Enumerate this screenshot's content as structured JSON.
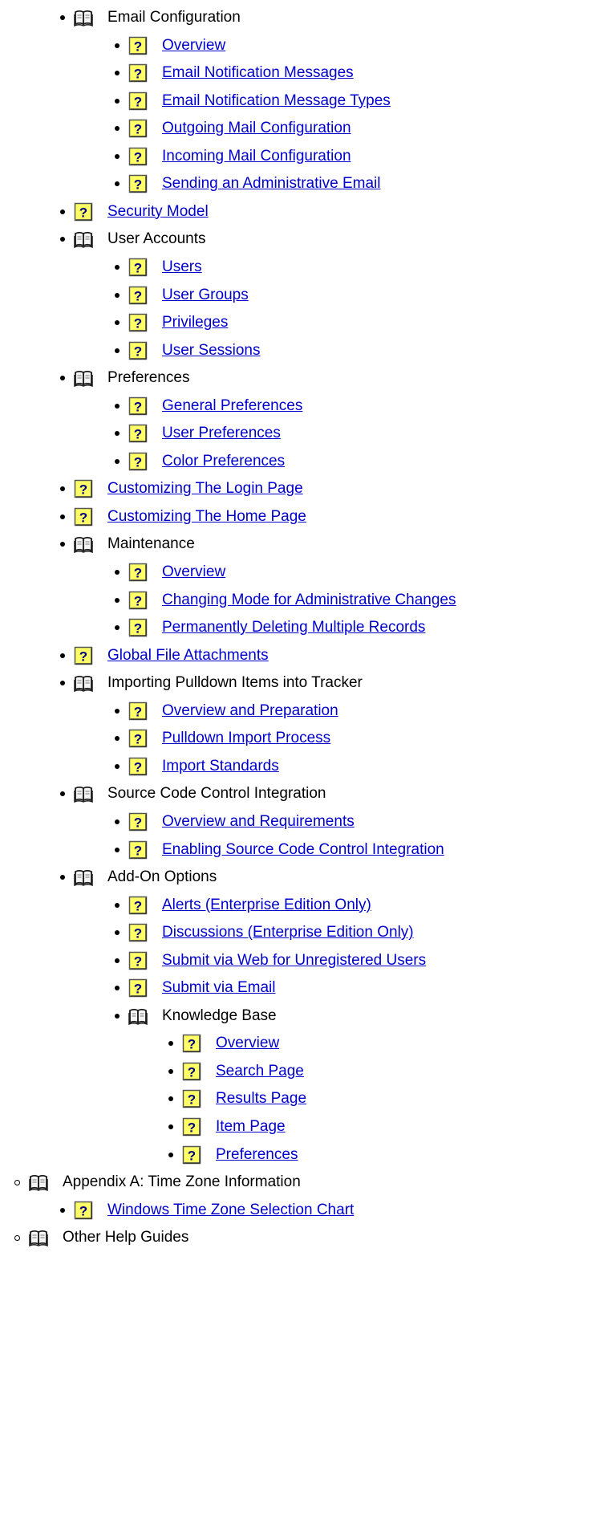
{
  "theme": {
    "link_color": "#0000cc",
    "text_color": "#000000",
    "help_icon_bg": "#ffff66",
    "help_icon_fg": "#000080"
  },
  "items": [
    {
      "level": 2,
      "type": "book",
      "label": "Email Configuration"
    },
    {
      "level": 3,
      "type": "page",
      "label": "Overview"
    },
    {
      "level": 3,
      "type": "page",
      "label": "Email Notification Messages"
    },
    {
      "level": 3,
      "type": "page",
      "label": "Email Notification Message Types"
    },
    {
      "level": 3,
      "type": "page",
      "label": "Outgoing Mail Configuration"
    },
    {
      "level": 3,
      "type": "page",
      "label": "Incoming Mail Configuration"
    },
    {
      "level": 3,
      "type": "page",
      "label": "Sending an Administrative Email"
    },
    {
      "level": 2,
      "type": "page",
      "label": "Security Model"
    },
    {
      "level": 2,
      "type": "book",
      "label": "User Accounts"
    },
    {
      "level": 3,
      "type": "page",
      "label": "Users"
    },
    {
      "level": 3,
      "type": "page",
      "label": "User Groups"
    },
    {
      "level": 3,
      "type": "page",
      "label": "Privileges"
    },
    {
      "level": 3,
      "type": "page",
      "label": "User Sessions"
    },
    {
      "level": 2,
      "type": "book",
      "label": "Preferences"
    },
    {
      "level": 3,
      "type": "page",
      "label": "General Preferences"
    },
    {
      "level": 3,
      "type": "page",
      "label": "User Preferences"
    },
    {
      "level": 3,
      "type": "page",
      "label": "Color Preferences"
    },
    {
      "level": 2,
      "type": "page",
      "label": "Customizing The Login Page"
    },
    {
      "level": 2,
      "type": "page",
      "label": "Customizing The Home Page"
    },
    {
      "level": 2,
      "type": "book",
      "label": "Maintenance"
    },
    {
      "level": 3,
      "type": "page",
      "label": "Overview"
    },
    {
      "level": 3,
      "type": "page",
      "label": "Changing Mode for Administrative Changes"
    },
    {
      "level": 3,
      "type": "page",
      "label": "Permanently Deleting Multiple Records"
    },
    {
      "level": 2,
      "type": "page",
      "label": "Global File Attachments"
    },
    {
      "level": 2,
      "type": "book",
      "label": "Importing Pulldown Items into Tracker"
    },
    {
      "level": 3,
      "type": "page",
      "label": "Overview and Preparation"
    },
    {
      "level": 3,
      "type": "page",
      "label": "Pulldown Import Process"
    },
    {
      "level": 3,
      "type": "page",
      "label": "Import Standards"
    },
    {
      "level": 2,
      "type": "book",
      "label": "Source Code Control Integration"
    },
    {
      "level": 3,
      "type": "page",
      "label": "Overview and Requirements"
    },
    {
      "level": 3,
      "type": "page",
      "label": "Enabling Source Code Control Integration"
    },
    {
      "level": 2,
      "type": "book",
      "label": "Add-On Options"
    },
    {
      "level": 3,
      "type": "page",
      "label": "Alerts (Enterprise Edition Only)"
    },
    {
      "level": 3,
      "type": "page",
      "label": "Discussions (Enterprise Edition Only)"
    },
    {
      "level": 3,
      "type": "page",
      "label": "Submit via Web for Unregistered Users"
    },
    {
      "level": 3,
      "type": "page",
      "label": "Submit via Email"
    },
    {
      "level": 3,
      "type": "book",
      "label": "Knowledge Base"
    },
    {
      "level": 4,
      "type": "page",
      "label": "Overview"
    },
    {
      "level": 4,
      "type": "page",
      "label": "Search Page"
    },
    {
      "level": 4,
      "type": "page",
      "label": "Results Page"
    },
    {
      "level": 4,
      "type": "page",
      "label": "Item Page"
    },
    {
      "level": 4,
      "type": "page",
      "label": "Preferences"
    },
    {
      "level": 1,
      "type": "book",
      "label": "Appendix A: Time Zone Information"
    },
    {
      "level": 2,
      "type": "page",
      "label": "Windows Time Zone Selection Chart"
    },
    {
      "level": 1,
      "type": "book",
      "label": "Other Help Guides"
    }
  ]
}
